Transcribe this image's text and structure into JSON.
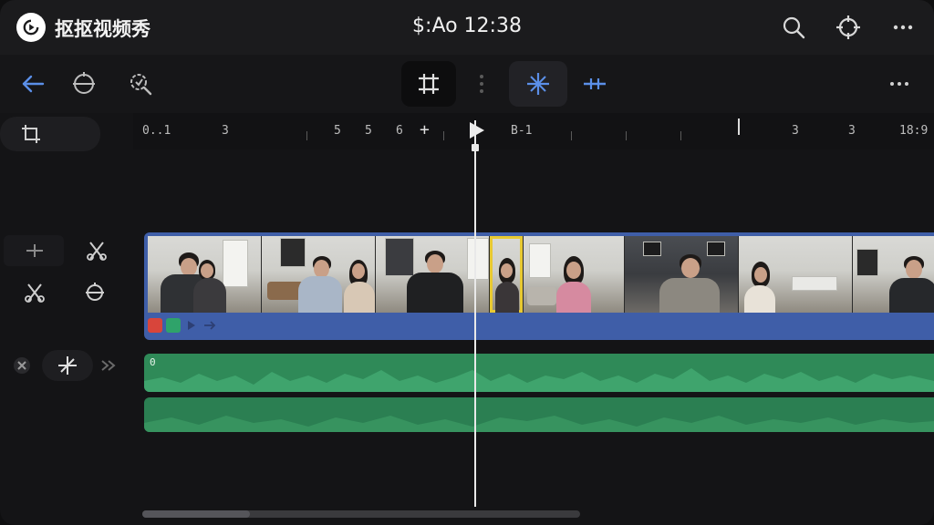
{
  "app": {
    "name": "抠抠视频秀",
    "clock": "$:Ao 12:38"
  },
  "colors": {
    "accent": "#5b8fe8",
    "video_track": "#3f5ea8",
    "audio_track": "#2f8a58",
    "selection": "#e8c931"
  },
  "titlebar_icons": [
    "search-icon",
    "crosshair-icon",
    "more-icon"
  ],
  "toolbar": {
    "left_icons": [
      "back-arrow-icon",
      "rotate-icon",
      "zoom-scan-icon"
    ],
    "center_icons": [
      "crop-frame-icon",
      "drag-handle-icon",
      "split-star-icon",
      "trim-icon"
    ],
    "right_icons": [
      "more-icon"
    ]
  },
  "ruler": {
    "labels": [
      "0..1",
      "3",
      "5",
      "5",
      "6",
      "+",
      "B-1",
      "3",
      "3",
      "18:9"
    ]
  },
  "tracks": {
    "audio_1_label": "0",
    "clip_count": 7
  }
}
